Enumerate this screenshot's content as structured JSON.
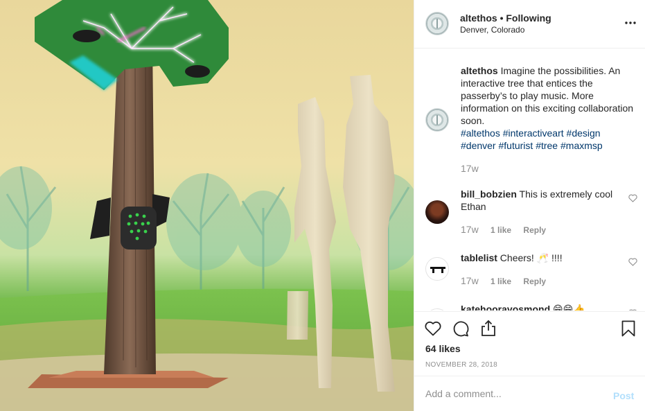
{
  "post": {
    "author": "altethos",
    "separator": "•",
    "follow_status": "Following",
    "location": "Denver, Colorado",
    "caption": {
      "username": "altethos",
      "text": "Imagine the possibilities. An interactive tree that entices the passerby’s to play music. More information on this exciting collaboration soon.",
      "hashtags": [
        "#altethos",
        "#interactiveart",
        "#design",
        "#denver",
        "#futurist",
        "#tree",
        "#maxmsp"
      ],
      "time": "17w"
    },
    "comments": [
      {
        "username": "bill_bobzien",
        "text": "This is extremely cool Ethan",
        "time": "17w",
        "likes": "1 like",
        "reply": "Reply"
      },
      {
        "username": "tablelist",
        "text": "Cheers! 🥂 !!!!",
        "time": "17w",
        "likes": "1 like",
        "reply": "Reply"
      },
      {
        "username": "katehooravosmond",
        "text": "😁😁👍",
        "time": "",
        "likes": "",
        "reply": ""
      }
    ],
    "likes_count": "64 likes",
    "date": "NOVEMBER 28, 2018",
    "add_comment": {
      "placeholder": "Add a comment...",
      "post_label": "Post"
    }
  },
  "icons": {
    "more": "more-options-icon",
    "like": "heart-icon",
    "comment": "comment-icon",
    "share": "share-icon",
    "save": "bookmark-icon",
    "comment_like": "heart-small-icon"
  },
  "colors": {
    "link": "#00376b",
    "muted": "#8e8e8e",
    "post_disabled": "#b2dffc"
  }
}
